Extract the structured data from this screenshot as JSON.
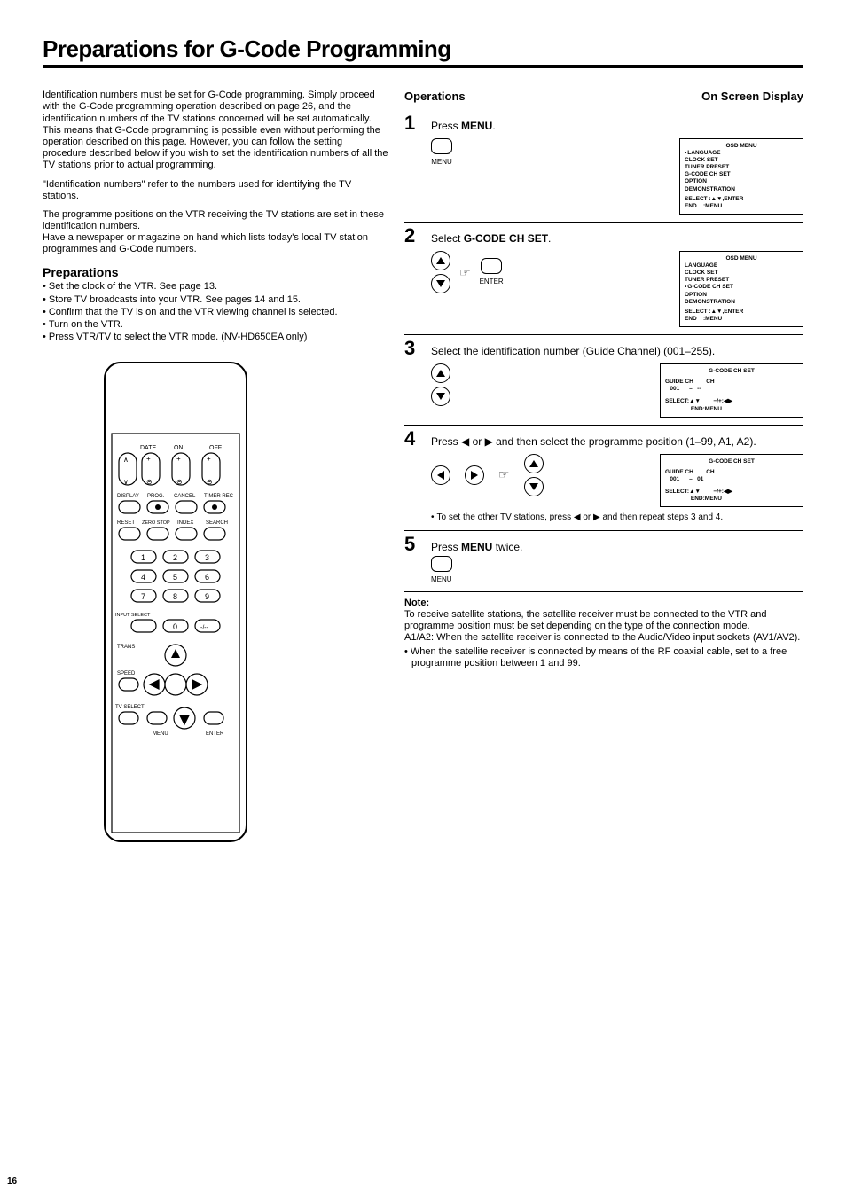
{
  "title": "Preparations for G-Code Programming",
  "intro": {
    "p1": "Identification numbers must be set for G-Code programming. Simply proceed with the G-Code programming operation described on page 26, and the identification numbers of the TV stations concerned will be set automatically. This means that G-Code programming is possible even without performing the operation described on this page. However, you can follow the setting procedure described below if you wish to set the identification numbers of all the TV stations prior to actual programming.",
    "p2": "\"Identification numbers\" refer to the numbers used for identifying the TV stations.",
    "p3": "The programme positions on the VTR receiving the TV stations are set in these identification numbers.",
    "p4": "Have a newspaper or magazine on hand which lists today's local TV station programmes and G-Code numbers."
  },
  "prep_heading": "Preparations",
  "prep_items": [
    "Set the clock of the VTR. See page 13.",
    "Store TV broadcasts into your VTR. See pages 14 and 15.",
    "Confirm that the TV is on and the VTR viewing channel is selected.",
    "Turn on the VTR.",
    "Press VTR/TV to select the VTR mode. (NV-HD650EA only)"
  ],
  "remote": {
    "labels": [
      "DATE",
      "ON",
      "OFF",
      "DISPLAY",
      "PROG.",
      "CANCEL",
      "TIMER REC",
      "RESET",
      "ZERO STOP",
      "INDEX",
      "SEARCH",
      "INPUT SELECT",
      "TRANS",
      "SPEED",
      "TV SELECT",
      "MENU",
      "ENTER",
      "1",
      "2",
      "3",
      "4",
      "5",
      "6",
      "7",
      "8",
      "9",
      "0",
      "-/--"
    ]
  },
  "ops_header": {
    "left": "Operations",
    "right": "On Screen Display"
  },
  "steps": [
    {
      "num": "1",
      "text_pre": "Press ",
      "text_bold": "MENU",
      "text_post": ".",
      "icon_label": "MENU",
      "osd": {
        "title": "OSD MENU",
        "lines": [
          "LANGUAGE",
          "CLOCK SET",
          "TUNER PRESET",
          "G-CODE CH SET",
          "OPTION",
          "DEMONSTRATION"
        ],
        "highlight": 0,
        "footer": "SELECT :▲▼,ENTER\nEND    :MENU"
      }
    },
    {
      "num": "2",
      "text_pre": "Select ",
      "text_bold": "G-CODE CH SET",
      "text_post": ".",
      "icon_label": "ENTER",
      "osd": {
        "title": "OSD MENU",
        "lines": [
          "LANGUAGE",
          "CLOCK SET",
          "TUNER PRESET",
          "G-CODE CH SET",
          "OPTION",
          "DEMONSTRATION"
        ],
        "highlight": 3,
        "footer": "SELECT :▲▼,ENTER\nEND    :MENU"
      }
    },
    {
      "num": "3",
      "text_pre": "Select the identification number (Guide Channel) (001–255).",
      "text_bold": "",
      "text_post": "",
      "icon_label": "",
      "osd": {
        "title": "G-CODE CH SET",
        "body_lines": [
          "GUIDE CH        CH",
          "   001      –   --"
        ],
        "footer": "SELECT:▲▼        −/+:◀▶\n                END:MENU"
      }
    },
    {
      "num": "4",
      "text_pre": "Press ◀ or ▶ and then select the programme position (1–99, A1, A2).",
      "text_bold": "",
      "text_post": "",
      "icon_label": "",
      "osd": {
        "title": "G-CODE CH SET",
        "body_lines": [
          "GUIDE CH        CH",
          "   001      –   01"
        ],
        "footer": "SELECT:▲▼        −/+:◀▶\n                END:MENU"
      },
      "substep": "To set the other TV stations, press ◀ or ▶ and then repeat steps 3 and 4."
    },
    {
      "num": "5",
      "text_pre": "Press ",
      "text_bold": "MENU",
      "text_post": " twice.",
      "icon_label": "MENU"
    }
  ],
  "note": {
    "label": "Note:",
    "lines": [
      "To receive satellite stations, the satellite receiver must be connected to the VTR and programme position must be set depending on the type of the connection mode.",
      "A1/A2: When the satellite receiver is connected to the Audio/Video input sockets (AV1/AV2)."
    ],
    "bullet": "When the satellite receiver is connected by means of the RF coaxial cable, set to a free programme position between 1 and 99."
  },
  "page_number": "16"
}
